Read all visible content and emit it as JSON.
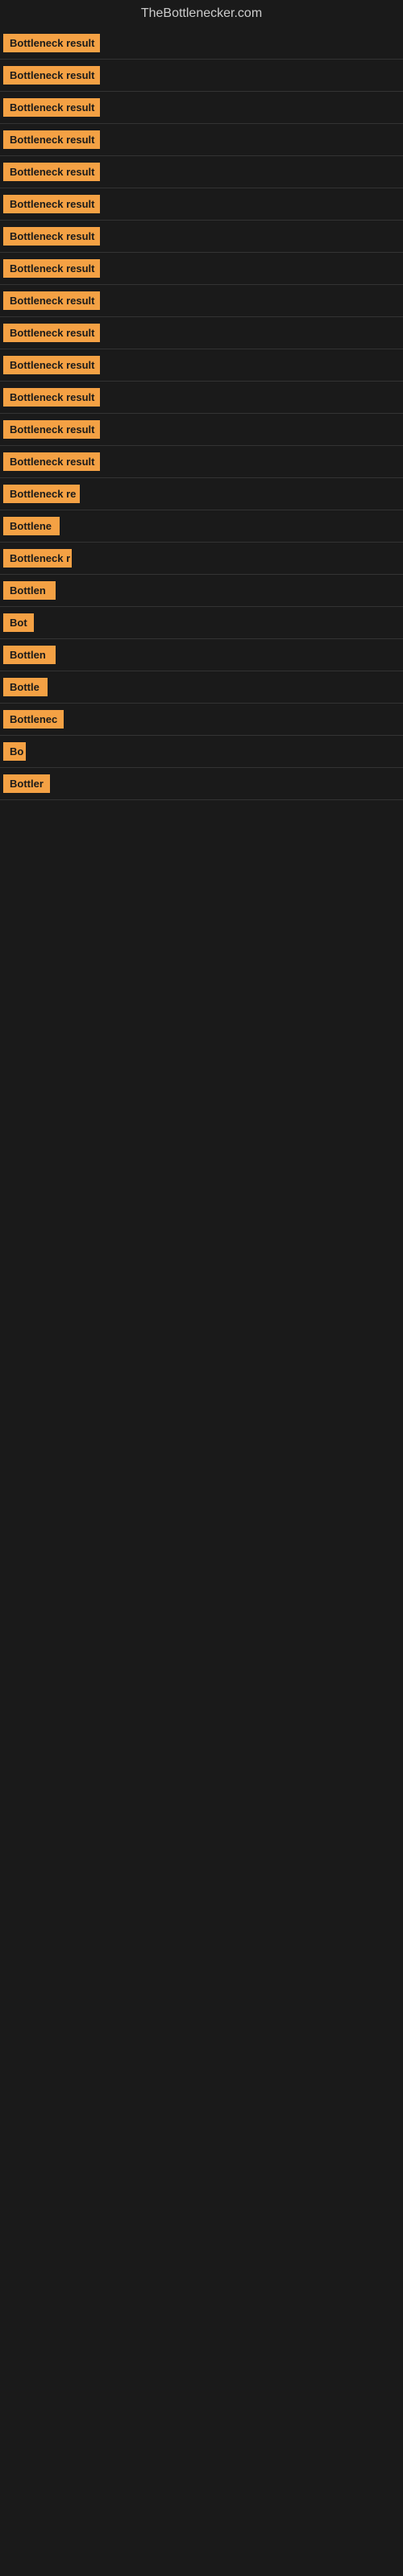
{
  "site": {
    "title": "TheBottlenecker.com"
  },
  "items": [
    {
      "id": 1,
      "label": "Bottleneck result",
      "badge_width": 120
    },
    {
      "id": 2,
      "label": "Bottleneck result",
      "badge_width": 120
    },
    {
      "id": 3,
      "label": "Bottleneck result",
      "badge_width": 120
    },
    {
      "id": 4,
      "label": "Bottleneck result",
      "badge_width": 120
    },
    {
      "id": 5,
      "label": "Bottleneck result",
      "badge_width": 120
    },
    {
      "id": 6,
      "label": "Bottleneck result",
      "badge_width": 120
    },
    {
      "id": 7,
      "label": "Bottleneck result",
      "badge_width": 120
    },
    {
      "id": 8,
      "label": "Bottleneck result",
      "badge_width": 120
    },
    {
      "id": 9,
      "label": "Bottleneck result",
      "badge_width": 120
    },
    {
      "id": 10,
      "label": "Bottleneck result",
      "badge_width": 120
    },
    {
      "id": 11,
      "label": "Bottleneck result",
      "badge_width": 120
    },
    {
      "id": 12,
      "label": "Bottleneck result",
      "badge_width": 120
    },
    {
      "id": 13,
      "label": "Bottleneck result",
      "badge_width": 120
    },
    {
      "id": 14,
      "label": "Bottleneck result",
      "badge_width": 120
    },
    {
      "id": 15,
      "label": "Bottleneck re",
      "badge_width": 95
    },
    {
      "id": 16,
      "label": "Bottlene",
      "badge_width": 70
    },
    {
      "id": 17,
      "label": "Bottleneck r",
      "badge_width": 85
    },
    {
      "id": 18,
      "label": "Bottlen",
      "badge_width": 65
    },
    {
      "id": 19,
      "label": "Bot",
      "badge_width": 38
    },
    {
      "id": 20,
      "label": "Bottlen",
      "badge_width": 65
    },
    {
      "id": 21,
      "label": "Bottle",
      "badge_width": 55
    },
    {
      "id": 22,
      "label": "Bottlenec",
      "badge_width": 75
    },
    {
      "id": 23,
      "label": "Bo",
      "badge_width": 28
    },
    {
      "id": 24,
      "label": "Bottler",
      "badge_width": 58
    }
  ]
}
